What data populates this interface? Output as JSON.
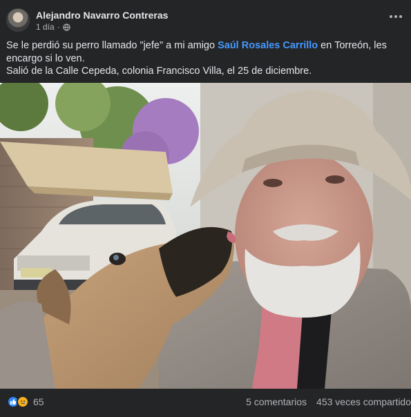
{
  "post": {
    "author": "Alejandro Navarro Contreras",
    "time": "1 día",
    "privacy_icon": "globe-icon",
    "more_icon": "more-options-icon",
    "text_part1": "Se le perdió su perro llamado \"jefe\" a mi amigo ",
    "mention": "Saúl Rosales Carrillo",
    "text_part2": " en Torreón, les encargo si lo ven.",
    "text_line2": "Salió de la Calle Cepeda, colonia Francisco Villa, el 25 de diciembre."
  },
  "footer": {
    "reaction_icons": [
      "like-icon",
      "sad-icon"
    ],
    "reaction_count": "65",
    "comments": "5 comentarios",
    "shares": "453 veces compartido"
  },
  "colors": {
    "background": "#242526",
    "link": "#4599ff",
    "secondary_text": "#b0b3b8",
    "like": "#2d88ff",
    "sad": "#f7b125"
  }
}
